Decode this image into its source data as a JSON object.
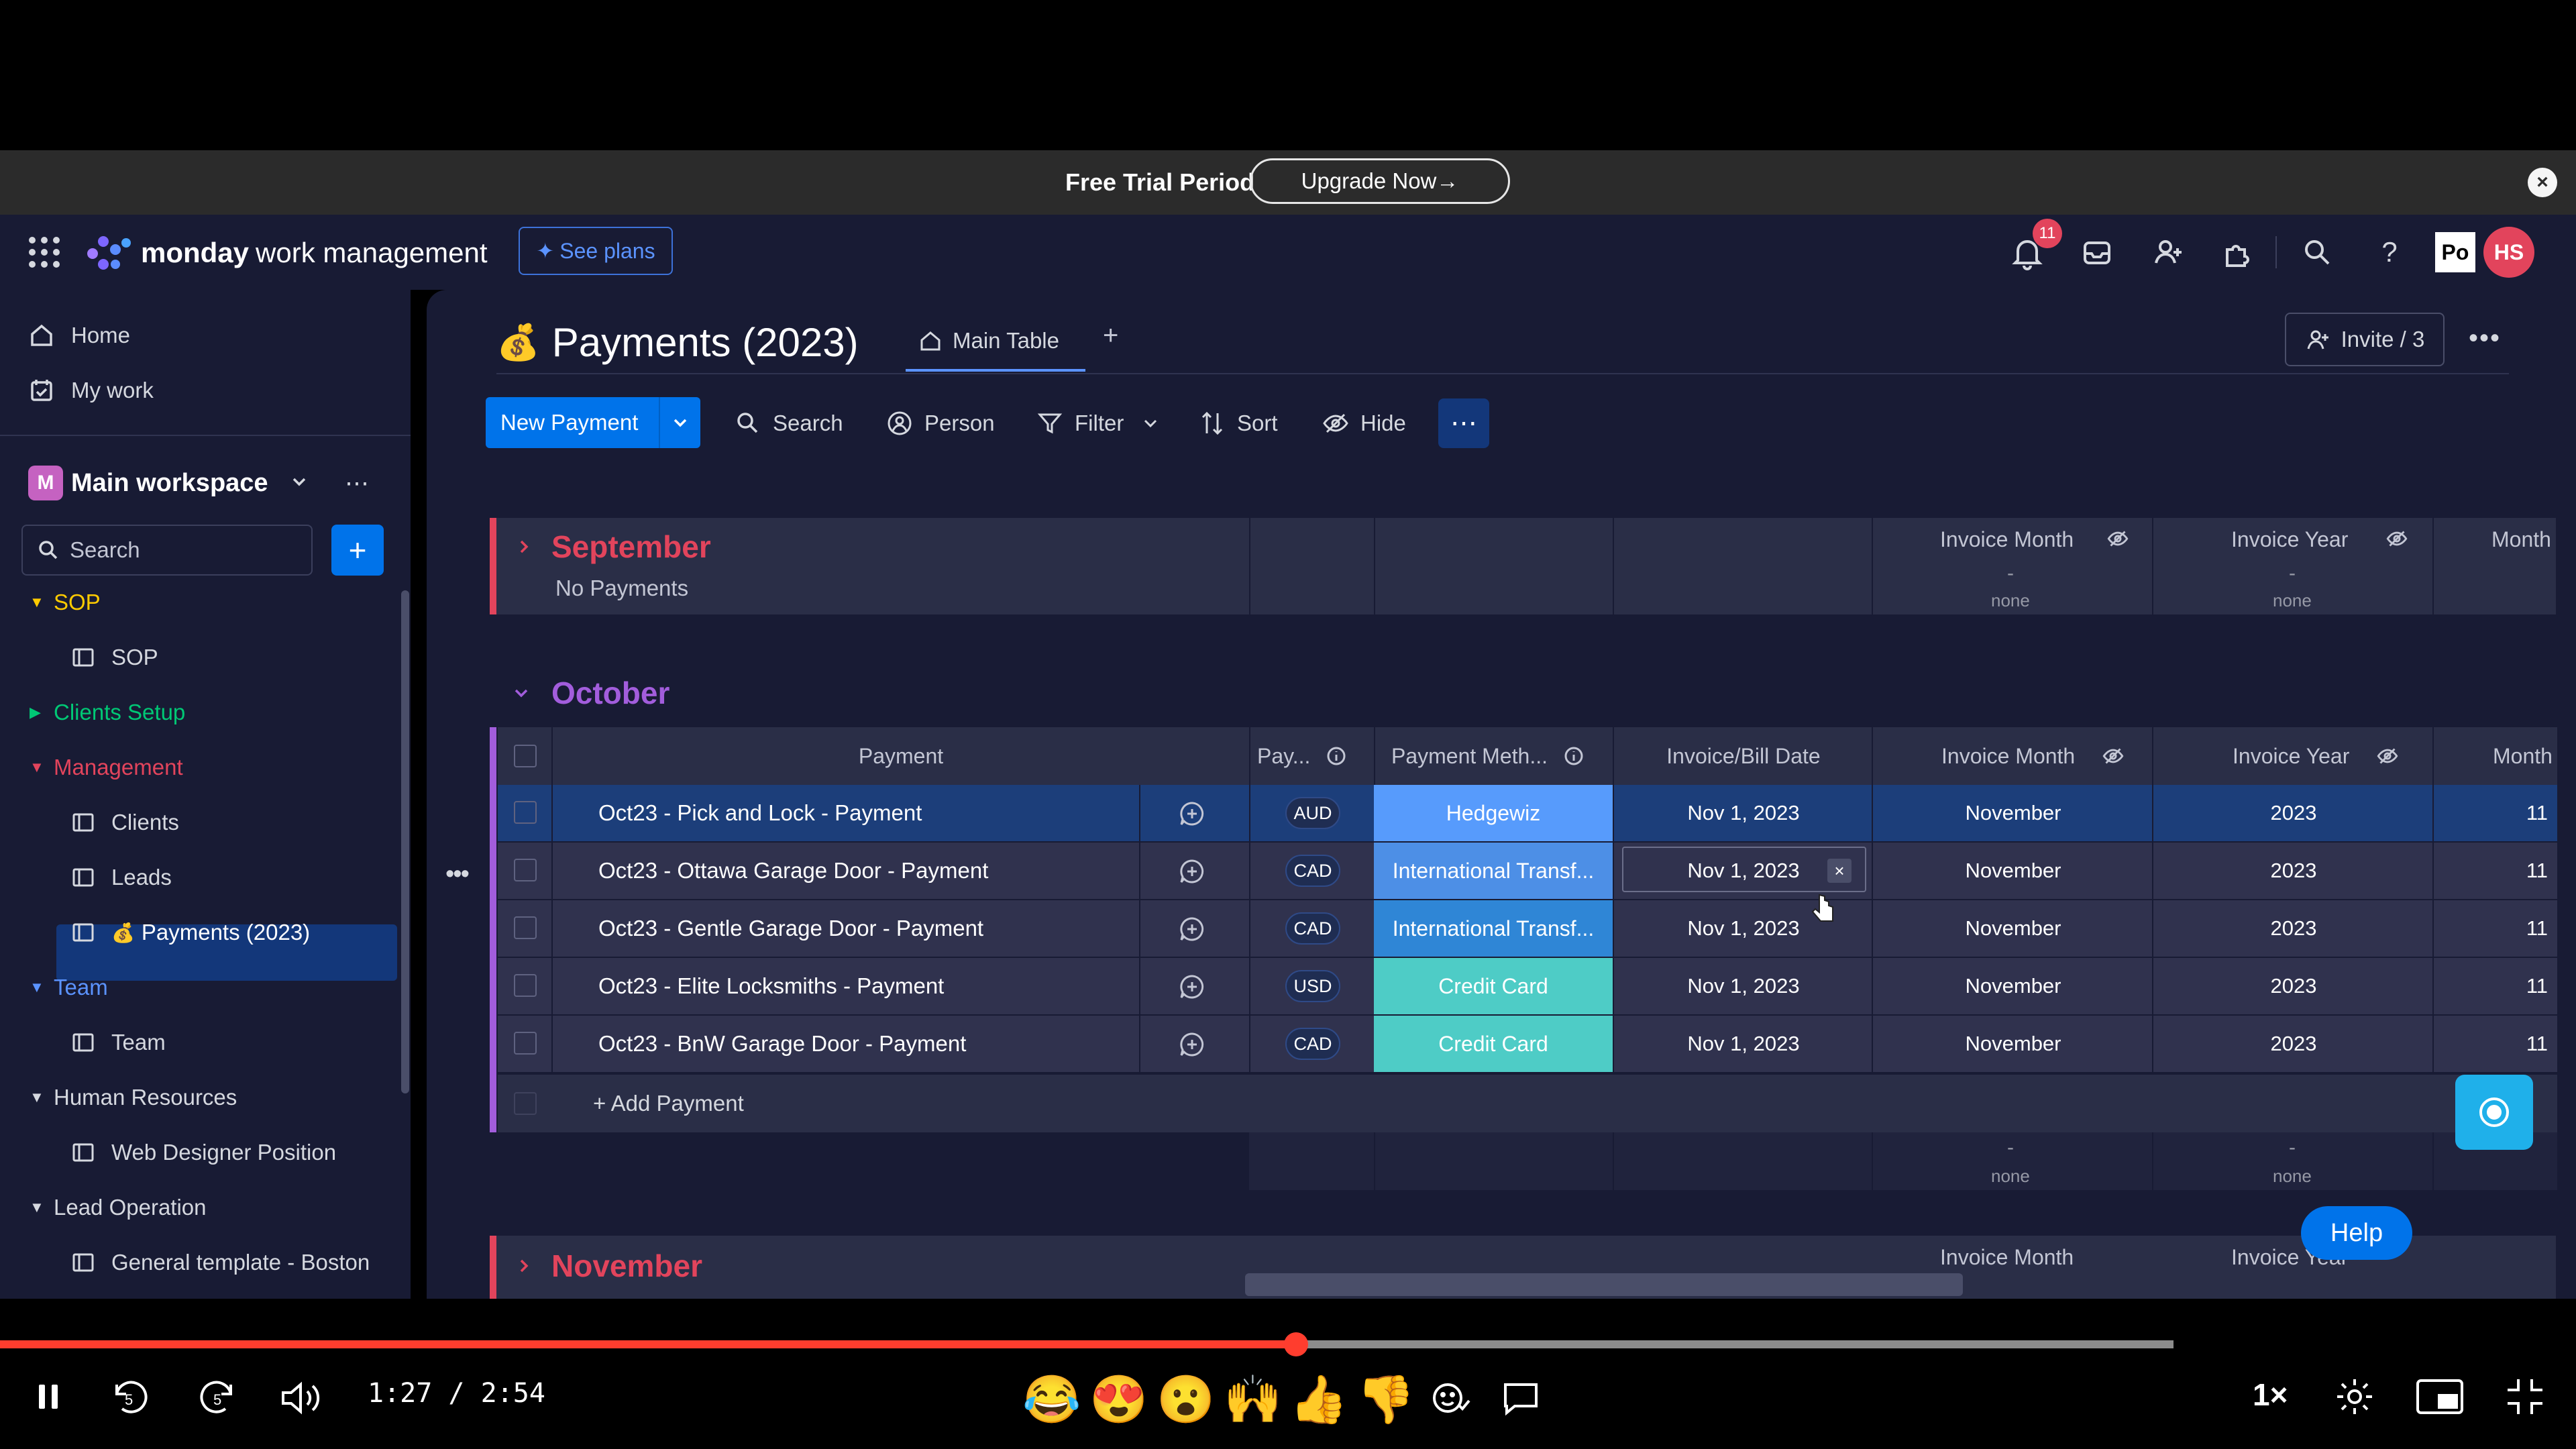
{
  "trial": {
    "text": "Free Trial Period",
    "upgrade": "Upgrade Now→"
  },
  "header": {
    "brand_bold": "monday",
    "brand_rest": "work management",
    "see_plans": "See plans",
    "notification_count": "11",
    "avatar_po": "Po",
    "avatar_initials": "HS"
  },
  "sidebar": {
    "home": "Home",
    "my_work": "My work",
    "workspace_initial": "M",
    "workspace": "Main workspace",
    "search": "Search",
    "tree": [
      {
        "label": "SOP",
        "color": "#ffcb00",
        "expanded": true
      },
      {
        "label": "SOP",
        "child": true
      },
      {
        "label": "Clients Setup",
        "color": "#00c875",
        "expanded": false
      },
      {
        "label": "Management",
        "color": "#e2445c",
        "expanded": true
      },
      {
        "label": "Clients",
        "child": true
      },
      {
        "label": "Leads",
        "child": true
      },
      {
        "label": "Payments (2023)",
        "child": true,
        "active": true
      },
      {
        "label": "Team",
        "color": "#5b93ff",
        "expanded": true
      },
      {
        "label": "Team",
        "child": true
      },
      {
        "label": "Human Resources",
        "color": "#d5d8df",
        "expanded": true
      },
      {
        "label": "Web Designer Position",
        "child": true
      },
      {
        "label": "Lead Operation",
        "color": "#d5d8df",
        "expanded": true
      },
      {
        "label": "General template - Boston",
        "child": true
      }
    ]
  },
  "board": {
    "title": "Payments (2023)",
    "tab_main": "Main Table",
    "invite": "Invite / 3",
    "toolbar": {
      "new": "New Payment",
      "search": "Search",
      "person": "Person",
      "filter": "Filter",
      "sort": "Sort",
      "hide": "Hide"
    }
  },
  "groups": {
    "september": {
      "title": "September",
      "empty": "No Payments",
      "color": "#e2445c"
    },
    "october": {
      "title": "October",
      "color": "#a25ddc",
      "add": "+ Add Payment"
    },
    "november": {
      "title": "November",
      "color": "#e2445c"
    }
  },
  "columns": {
    "payment": "Payment",
    "pay": "Pay...",
    "method": "Payment Meth...",
    "date": "Invoice/Bill Date",
    "month": "Invoice Month",
    "year": "Invoice Year",
    "month_num": "Month"
  },
  "summary": {
    "dash": "-",
    "none": "none"
  },
  "rows": [
    {
      "name": "Oct23 - Pick and Lock - Payment",
      "cur": "AUD",
      "method": "Hedgewiz",
      "method_color": "#579bfc",
      "date": "Nov 1, 2023",
      "month": "November",
      "year": "2023",
      "num": "11"
    },
    {
      "name": "Oct23 - Ottawa Garage Door - Payment",
      "cur": "CAD",
      "method": "International Transf...",
      "method_color": "#4d8fe6",
      "date": "Nov 1, 2023",
      "month": "November",
      "year": "2023",
      "num": "11"
    },
    {
      "name": "Oct23 - Gentle Garage Door - Payment",
      "cur": "CAD",
      "method": "International Transf...",
      "method_color": "#2f86d6",
      "date": "Nov 1, 2023",
      "month": "November",
      "year": "2023",
      "num": "11"
    },
    {
      "name": "Oct23 - Elite Locksmiths - Payment",
      "cur": "USD",
      "method": "Credit Card",
      "method_color": "#4eccc6",
      "date": "Nov 1, 2023",
      "month": "November",
      "year": "2023",
      "num": "11"
    },
    {
      "name": "Oct23 - BnW Garage Door - Payment",
      "cur": "CAD",
      "method": "Credit Card",
      "method_color": "#4eccc6",
      "date": "Nov 1, 2023",
      "month": "November",
      "year": "2023",
      "num": "11"
    }
  ],
  "help": "Help",
  "player": {
    "time": "1:27 / 2:54",
    "progress": 0.5,
    "speed": "1×",
    "emojis": [
      "😂",
      "😍",
      "😮",
      "🙌",
      "👍",
      "👎"
    ]
  }
}
